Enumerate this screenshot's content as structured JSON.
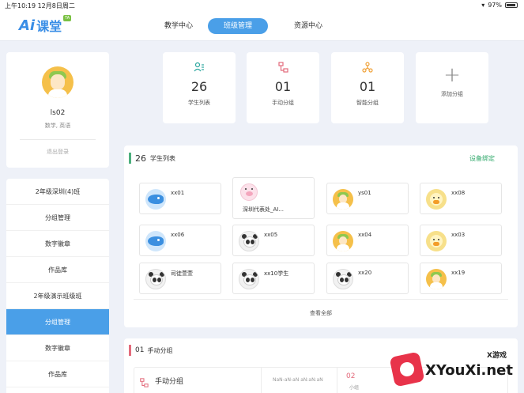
{
  "status_bar": {
    "time": "上午10:19  12月8日周二",
    "battery": "97%"
  },
  "header": {
    "logo_ai": "Ai",
    "logo_text": "课堂",
    "logo_tag": "TA",
    "tabs": [
      {
        "label": "教学中心",
        "active": false
      },
      {
        "label": "班级管理",
        "active": true
      },
      {
        "label": "资源中心",
        "active": false
      }
    ],
    "active_color": "#4a9fe8"
  },
  "profile": {
    "username": "ls02",
    "subjects": "数学, 英语",
    "logout": "退出登录"
  },
  "classes": [
    {
      "label": "2年级深圳(4)班",
      "active": false
    },
    {
      "label": "分组管理",
      "active": false
    },
    {
      "label": "数字徽章",
      "active": false
    },
    {
      "label": "作品库",
      "active": false
    },
    {
      "label": "2年级演示班级班",
      "active": false
    },
    {
      "label": "分组管理",
      "active": true
    },
    {
      "label": "数字徽章",
      "active": false
    },
    {
      "label": "作品库",
      "active": false
    }
  ],
  "stats": [
    {
      "icon": "student-list-icon",
      "value": "26",
      "label": "学生列表",
      "color": "#2fa8a0"
    },
    {
      "icon": "manual-group-icon",
      "value": "01",
      "label": "手动分组",
      "color": "#e36b7c"
    },
    {
      "icon": "smart-group-icon",
      "value": "01",
      "label": "智能分组",
      "color": "#f0a23a"
    },
    {
      "icon": "plus-icon",
      "value": "",
      "label": "添加分组"
    }
  ],
  "students_panel": {
    "count": "26",
    "title": "学生列表",
    "device_bind": "设备绑定",
    "view_all": "查看全部",
    "students": [
      {
        "name": "xx01",
        "avatar": "fish"
      },
      {
        "name": "深圳代表处_AI...",
        "avatar": "pig"
      },
      {
        "name": "ys01",
        "avatar": "girl"
      },
      {
        "name": "xx08",
        "avatar": "duck"
      },
      {
        "name": "xx06",
        "avatar": "fish"
      },
      {
        "name": "xx05",
        "avatar": "panda"
      },
      {
        "name": "xx04",
        "avatar": "girl"
      },
      {
        "name": "xx03",
        "avatar": "duck"
      },
      {
        "name": "司徒萱萱",
        "avatar": "panda"
      },
      {
        "name": "xx10学生",
        "avatar": "panda"
      },
      {
        "name": "xx20",
        "avatar": "panda"
      },
      {
        "name": "xx19",
        "avatar": "girl"
      }
    ]
  },
  "group_panel": {
    "count": "01",
    "title": "手动分组",
    "row": {
      "name": "手动分组",
      "timestamp": "NaN-aN-aN aN:aN:aN",
      "num": "02",
      "unit": "小组"
    }
  },
  "watermark": {
    "small": "X游戏",
    "big": "XYouXi.net"
  }
}
